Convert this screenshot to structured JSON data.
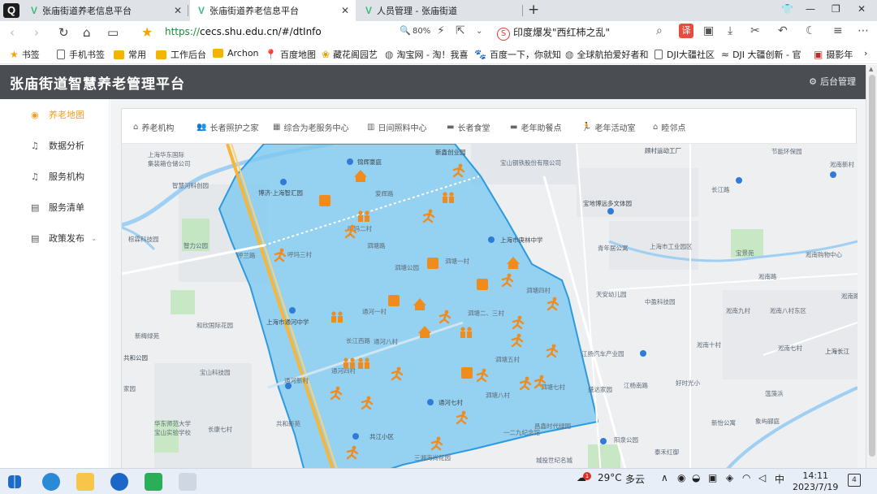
{
  "browser": {
    "tabs": [
      {
        "title": "张庙街道养老信息平台",
        "active": false
      },
      {
        "title": "张庙街道养老信息平台",
        "active": true
      },
      {
        "title": "人员管理 - 张庙街道",
        "active": false
      }
    ],
    "url_scheme": "https://",
    "url_rest": "cecs.shu.edu.cn/#/dtInfo",
    "zoom": "80%",
    "news": "印度爆发\"西红柿之乱\"",
    "translate_label": "译"
  },
  "bookmarks": [
    {
      "label": "书签",
      "icon": "star-icon"
    },
    {
      "label": "手机书签",
      "icon": "page-icon"
    },
    {
      "label": "常用",
      "icon": "folder-icon"
    },
    {
      "label": "工作后台",
      "icon": "folder-icon"
    },
    {
      "label": "Archon",
      "icon": "folder-icon"
    },
    {
      "label": "百度地图",
      "icon": "map-pin-icon"
    },
    {
      "label": "藏花阁园艺",
      "icon": "flower-icon"
    },
    {
      "label": "淘宝网 - 淘！我喜",
      "icon": "globe-icon"
    },
    {
      "label": "百度一下，你就知",
      "icon": "paw-icon"
    },
    {
      "label": "全球航拍爱好者和",
      "icon": "globe-icon"
    },
    {
      "label": "DJI大疆社区",
      "icon": "page-icon"
    },
    {
      "label": "DJI 大疆创新 - 官",
      "icon": "dji-icon"
    },
    {
      "label": "摄影年",
      "icon": "photo-icon"
    }
  ],
  "app": {
    "title": "张庙街道智慧养老管理平台",
    "admin_label": "后台管理"
  },
  "sidebar": {
    "items": [
      {
        "label": "养老地图",
        "icon": "location-icon",
        "active": true
      },
      {
        "label": "数据分析",
        "icon": "bell-icon",
        "active": false
      },
      {
        "label": "服务机构",
        "icon": "bell-icon",
        "active": false
      },
      {
        "label": "服务清单",
        "icon": "document-icon",
        "active": false
      },
      {
        "label": "政策发布",
        "icon": "document-icon",
        "active": false,
        "expandable": true
      }
    ]
  },
  "filters": [
    {
      "label": "养老机构",
      "icon": "home-icon"
    },
    {
      "label": "长者照护之家",
      "icon": "people-icon"
    },
    {
      "label": "综合为老服务中心",
      "icon": "building-icon"
    },
    {
      "label": "日间照料中心",
      "icon": "calendar-icon"
    },
    {
      "label": "长者食堂",
      "icon": "canteen-icon"
    },
    {
      "label": "老年助餐点",
      "icon": "meal-icon"
    },
    {
      "label": "老年活动室",
      "icon": "activity-icon"
    },
    {
      "label": "睦邻点",
      "icon": "neighbor-icon"
    }
  ],
  "map": {
    "region_color": "#7cc8f0",
    "marker_color": "#f08c1e",
    "labels": [
      "上海华东国际",
      "集装箱仓储公司",
      "智慧河科创园",
      "棕霖科技园",
      "智力公园",
      "呼兰路",
      "和欣国际花园",
      "新梅绿苑",
      "共和公园",
      "家园",
      "宝山科技园",
      "华东师范大学",
      "宝山实验学校",
      "长康七村",
      "共和新苑",
      "通河四村",
      "长江西路",
      "通河新村",
      "通河八村",
      "通河七村",
      "共江小区",
      "三湘海尚花园",
      "锦辉豪庭",
      "博济·上海智汇园",
      "爱辉路",
      "呼玛三村",
      "呼玛二村",
      "通河一村",
      "泗塘公园",
      "泗塘一村",
      "泗塘二、三村",
      "泗塘四村",
      "泗塘五村",
      "泗塘八村",
      "泗塘七村",
      "上海市通河中学",
      "上海市庚林中学",
      "宝山钢铁股份有限公司",
      "新鑫创业园",
      "顾村运动工厂",
      "宝地博远多文体园",
      "青年居公寓",
      "上海市工业园区",
      "长江路",
      "天安幼儿园",
      "中盈科技园",
      "江扬汽车产业园",
      "好时光小",
      "淞南九村",
      "淞南八村东区",
      "淞南十村",
      "淞南七村",
      "上海长江",
      "节能环保园",
      "淞南新村",
      "宝景苑",
      "淞南购物中心",
      "淞南路",
      "盛达家园",
      "淞南路",
      "象屿郦庭",
      "新怡公寓",
      "泰禾红御",
      "阳泉公园",
      "昌鑫时代绿园",
      "一二九纪念馆",
      "城投世纪名城",
      "泗塘路",
      "蕰藻浜",
      "江杨南路"
    ]
  },
  "taskbar": {
    "temperature": "29°C",
    "weather": "多云",
    "weather_badge": "1",
    "ime": "中",
    "time": "14:11",
    "date": "2023/7/19",
    "notification_count": "4"
  }
}
